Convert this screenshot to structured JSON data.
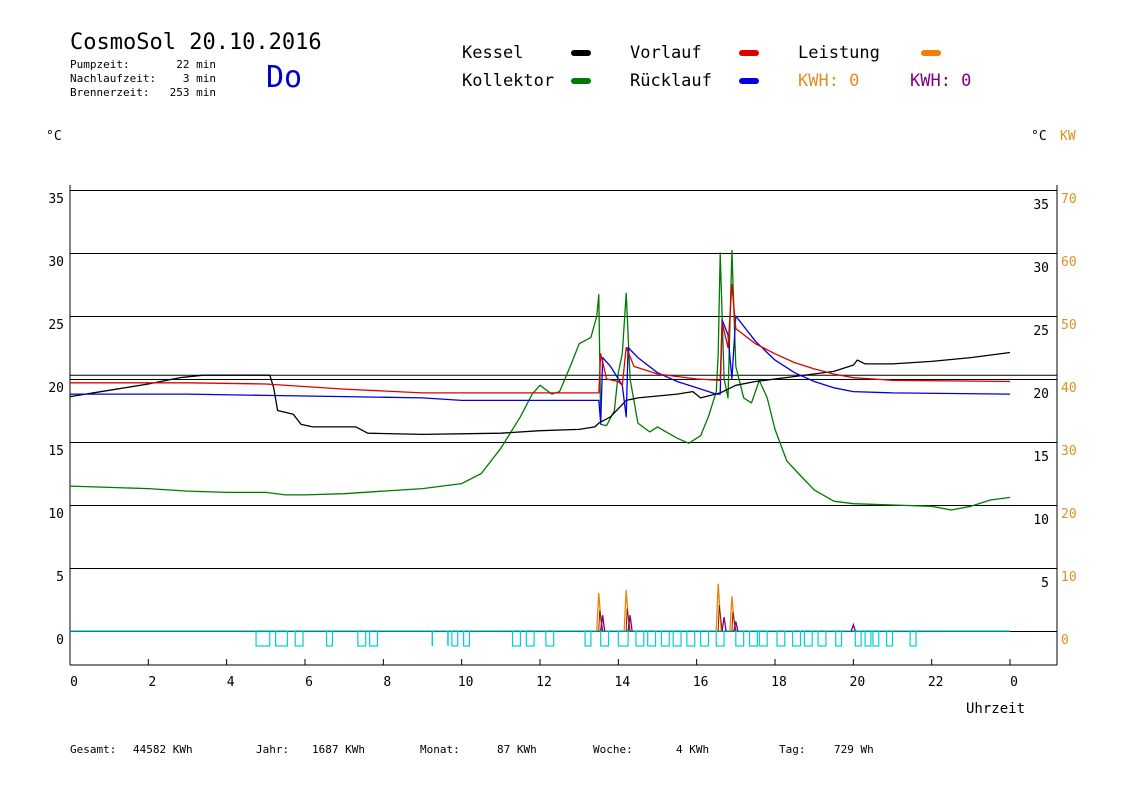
{
  "header": {
    "title": "CosmoSol 20.10.2016",
    "day": "Do",
    "stats": [
      {
        "label": "Pumpzeit:",
        "value": "22 min"
      },
      {
        "label": "Nachlaufzeit:",
        "value": "3 min"
      },
      {
        "label": "Brennerzeit:",
        "value": "253 min"
      }
    ]
  },
  "legend": {
    "kessel": "Kessel",
    "kollektor": "Kollektor",
    "vorlauf": "Vorlauf",
    "ruecklauf": "Rücklauf",
    "leistung": "Leistung",
    "kwh1": "KWH: 0",
    "kwh2": "KWH: 0"
  },
  "axes": {
    "left_unit": "°C",
    "right_unit": "°C",
    "right_unit2": "KW",
    "xlabel": "Uhrzeit"
  },
  "footer": {
    "gesamt_label": "Gesamt:",
    "gesamt_value": "44582 KWh",
    "jahr_label": "Jahr:",
    "jahr_value": "1687 KWh",
    "monat_label": "Monat:",
    "monat_value": "87 KWh",
    "woche_label": "Woche:",
    "woche_value": "4 KWh",
    "tag_label": "Tag:",
    "tag_value": "729 Wh"
  },
  "colors": {
    "kessel": "#000000",
    "kollektor": "#007a00",
    "vorlauf": "#e00000",
    "ruecklauf": "#0000e0",
    "leistung": "#f08000",
    "kwh2": "#800080",
    "pump": "#00d0d0",
    "kw_axis": "#e09020"
  },
  "chart_data": {
    "type": "line",
    "xlabel": "Uhrzeit",
    "ylabel": "°C",
    "y2label": "KW",
    "xlim": [
      0,
      24
    ],
    "ylim": [
      -2.5,
      36
    ],
    "y2lim": [
      -5,
      72
    ],
    "x_ticks": [
      "0",
      "2",
      "4",
      "6",
      "8",
      "10",
      "12",
      "14",
      "16",
      "18",
      "20",
      "22",
      "0"
    ],
    "y_ticks_left": [
      35,
      30,
      25,
      20,
      15,
      10,
      5,
      0
    ],
    "y_ticks_right": [
      35,
      30,
      25,
      20,
      15,
      10,
      5
    ],
    "y2_ticks": [
      70,
      60,
      50,
      40,
      30,
      20,
      10,
      0
    ],
    "series": [
      {
        "name": "Kessel",
        "key": "kessel",
        "points": [
          [
            0,
            18.6
          ],
          [
            1,
            19.1
          ],
          [
            2,
            19.6
          ],
          [
            2.8,
            20.1
          ],
          [
            3.4,
            20.3
          ],
          [
            5.1,
            20.3
          ],
          [
            5.2,
            19.3
          ],
          [
            5.3,
            17.5
          ],
          [
            5.7,
            17.2
          ],
          [
            5.9,
            16.4
          ],
          [
            6.2,
            16.2
          ],
          [
            7.3,
            16.2
          ],
          [
            7.6,
            15.7
          ],
          [
            9,
            15.6
          ],
          [
            11,
            15.7
          ],
          [
            12,
            15.9
          ],
          [
            13,
            16
          ],
          [
            13.4,
            16.2
          ],
          [
            13.5,
            16.5
          ],
          [
            13.8,
            17
          ],
          [
            14.2,
            18.3
          ],
          [
            14.5,
            18.5
          ],
          [
            15.5,
            18.8
          ],
          [
            15.9,
            19
          ],
          [
            16.1,
            18.5
          ],
          [
            16.6,
            18.9
          ],
          [
            17,
            19.5
          ],
          [
            17.5,
            19.8
          ],
          [
            18.5,
            20.2
          ],
          [
            19.5,
            20.6
          ],
          [
            20,
            21.1
          ],
          [
            20.1,
            21.5
          ],
          [
            20.3,
            21.2
          ],
          [
            21,
            21.2
          ],
          [
            22,
            21.4
          ],
          [
            23,
            21.7
          ],
          [
            24,
            22.1
          ]
        ]
      },
      {
        "name": "Vorlauf",
        "key": "vorlauf",
        "points": [
          [
            0,
            19.7
          ],
          [
            3,
            19.7
          ],
          [
            5,
            19.6
          ],
          [
            7,
            19.2
          ],
          [
            9,
            18.9
          ],
          [
            11,
            18.9
          ],
          [
            13.5,
            18.9
          ],
          [
            13.55,
            22
          ],
          [
            13.7,
            20
          ],
          [
            14,
            19.8
          ],
          [
            14.1,
            19.5
          ],
          [
            14.2,
            22.5
          ],
          [
            14.4,
            21
          ],
          [
            15,
            20.4
          ],
          [
            16,
            20
          ],
          [
            16.6,
            19.9
          ],
          [
            16.65,
            24.5
          ],
          [
            16.8,
            22.5
          ],
          [
            16.9,
            27.5
          ],
          [
            17,
            24
          ],
          [
            17.5,
            22.8
          ],
          [
            18,
            22
          ],
          [
            18.5,
            21.3
          ],
          [
            19,
            20.8
          ],
          [
            19.5,
            20.4
          ],
          [
            20,
            20.1
          ],
          [
            21,
            19.9
          ],
          [
            24,
            19.8
          ]
        ]
      },
      {
        "name": "Rücklauf",
        "key": "ruecklauf",
        "points": [
          [
            0,
            18.8
          ],
          [
            3,
            18.8
          ],
          [
            5,
            18.7
          ],
          [
            7,
            18.6
          ],
          [
            9,
            18.5
          ],
          [
            10,
            18.3
          ],
          [
            13.5,
            18.3
          ],
          [
            13.55,
            16.5
          ],
          [
            13.6,
            21.7
          ],
          [
            13.8,
            21
          ],
          [
            14.1,
            19.5
          ],
          [
            14.2,
            17
          ],
          [
            14.25,
            22.5
          ],
          [
            14.5,
            21.7
          ],
          [
            15,
            20.5
          ],
          [
            15.5,
            19.8
          ],
          [
            16,
            19.3
          ],
          [
            16.5,
            18.8
          ],
          [
            16.6,
            18.8
          ],
          [
            16.65,
            24.7
          ],
          [
            16.8,
            23.5
          ],
          [
            16.9,
            20
          ],
          [
            17,
            25
          ],
          [
            17.5,
            23
          ],
          [
            18,
            21.5
          ],
          [
            18.5,
            20.5
          ],
          [
            19,
            19.8
          ],
          [
            19.5,
            19.3
          ],
          [
            20,
            19
          ],
          [
            21,
            18.9
          ],
          [
            24,
            18.8
          ]
        ]
      },
      {
        "name": "Kollektor",
        "key": "kollektor",
        "points": [
          [
            0,
            11.5
          ],
          [
            1,
            11.4
          ],
          [
            2,
            11.3
          ],
          [
            3,
            11.1
          ],
          [
            4,
            11.0
          ],
          [
            5,
            11.0
          ],
          [
            5.5,
            10.8
          ],
          [
            6,
            10.8
          ],
          [
            7,
            10.9
          ],
          [
            8,
            11.1
          ],
          [
            9,
            11.3
          ],
          [
            10,
            11.7
          ],
          [
            10.5,
            12.5
          ],
          [
            11,
            14.5
          ],
          [
            11.5,
            17
          ],
          [
            11.8,
            18.8
          ],
          [
            12,
            19.5
          ],
          [
            12.3,
            18.8
          ],
          [
            12.5,
            19
          ],
          [
            12.8,
            21.2
          ],
          [
            13,
            22.8
          ],
          [
            13.3,
            23.3
          ],
          [
            13.45,
            25
          ],
          [
            13.5,
            26.7
          ],
          [
            13.55,
            16.4
          ],
          [
            13.7,
            16.3
          ],
          [
            13.9,
            17.5
          ],
          [
            14,
            20.5
          ],
          [
            14.1,
            22
          ],
          [
            14.2,
            26.8
          ],
          [
            14.3,
            20
          ],
          [
            14.5,
            16.5
          ],
          [
            14.8,
            15.8
          ],
          [
            15,
            16.2
          ],
          [
            15.5,
            15.3
          ],
          [
            15.8,
            14.9
          ],
          [
            16.1,
            15.5
          ],
          [
            16.3,
            17
          ],
          [
            16.5,
            19
          ],
          [
            16.55,
            22
          ],
          [
            16.6,
            30
          ],
          [
            16.7,
            20
          ],
          [
            16.8,
            18.5
          ],
          [
            16.9,
            30.2
          ],
          [
            17,
            21
          ],
          [
            17.2,
            18.5
          ],
          [
            17.4,
            18.1
          ],
          [
            17.6,
            19.9
          ],
          [
            17.8,
            18.5
          ],
          [
            18,
            16
          ],
          [
            18.3,
            13.5
          ],
          [
            18.6,
            12.5
          ],
          [
            19,
            11.2
          ],
          [
            19.5,
            10.3
          ],
          [
            20,
            10.1
          ],
          [
            21,
            10
          ],
          [
            22,
            9.9
          ],
          [
            22.5,
            9.6
          ],
          [
            23,
            9.9
          ],
          [
            23.5,
            10.4
          ],
          [
            24,
            10.6
          ]
        ]
      }
    ],
    "leistung": {
      "name": "Leistung",
      "spikes_kw": [
        [
          13.5,
          6
        ],
        [
          14.2,
          6.5
        ],
        [
          16.55,
          7.5
        ],
        [
          16.9,
          5.5
        ]
      ]
    },
    "kwh2_spikes": [
      [
        13.6,
        2.5
      ],
      [
        14.3,
        2.5
      ],
      [
        16.7,
        2.2
      ],
      [
        17.0,
        1.5
      ],
      [
        20.0,
        1
      ]
    ],
    "pump_blocks_x": [
      [
        4.75,
        5.1
      ],
      [
        5.25,
        5.55
      ],
      [
        5.75,
        5.95
      ],
      [
        6.55,
        6.7
      ],
      [
        7.35,
        7.55
      ],
      [
        7.65,
        7.85
      ],
      [
        9.75,
        9.9
      ],
      [
        10.05,
        10.2
      ],
      [
        11.3,
        11.5
      ],
      [
        11.65,
        11.85
      ],
      [
        12.15,
        12.35
      ],
      [
        13.15,
        13.3
      ],
      [
        13.55,
        13.75
      ],
      [
        14,
        14.25
      ],
      [
        14.45,
        14.65
      ],
      [
        14.75,
        14.95
      ],
      [
        15.1,
        15.3
      ],
      [
        15.4,
        15.6
      ],
      [
        15.75,
        15.95
      ],
      [
        16.1,
        16.3
      ],
      [
        16.5,
        16.7
      ],
      [
        17,
        17.2
      ],
      [
        17.35,
        17.55
      ],
      [
        17.6,
        17.8
      ],
      [
        18.05,
        18.25
      ],
      [
        18.45,
        18.65
      ],
      [
        18.75,
        18.95
      ],
      [
        19.1,
        19.3
      ],
      [
        19.55,
        19.7
      ],
      [
        20.05,
        20.2
      ],
      [
        20.3,
        20.45
      ],
      [
        20.5,
        20.65
      ],
      [
        20.85,
        21.0
      ],
      [
        21.45,
        21.6
      ]
    ],
    "pump_spikes_x": [
      9.25,
      9.65
    ]
  }
}
